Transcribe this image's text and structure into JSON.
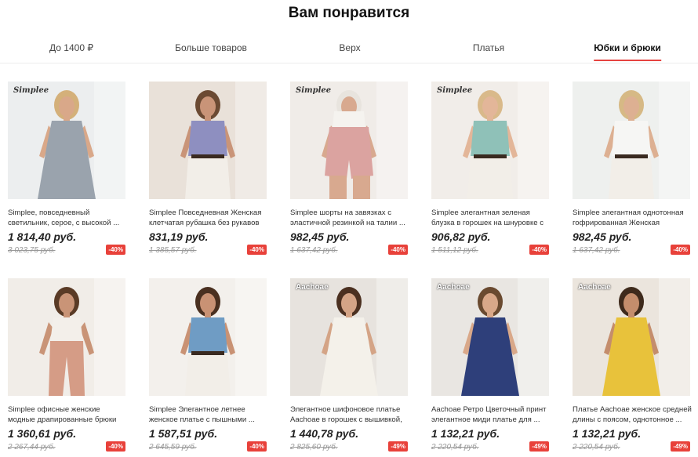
{
  "section_title": "Вам понравится",
  "tabs": [
    {
      "label": "До 1400 ₽"
    },
    {
      "label": "Больше товаров"
    },
    {
      "label": "Верх"
    },
    {
      "label": "Платья"
    },
    {
      "label": "Юбки и брюки"
    }
  ],
  "active_tab": "Юбки и брюки",
  "products": [
    {
      "brand_logo": "Simplee",
      "name": "Simplee, повседневный светильник, серое, с высокой ...",
      "price": "1 814,40 руб.",
      "old_price": "3 023,75 руб.",
      "discount": "-40%",
      "bg": "#eceeef",
      "dress": "#9aa3ad",
      "skin": "#d9a889",
      "hair": "#d4b07a"
    },
    {
      "brand_logo": "",
      "name": "Simplee Повседневная Женская клетчатая рубашка без рукавов с...",
      "price": "831,19 руб.",
      "old_price": "1 385,57 руб.",
      "discount": "-40%",
      "bg": "#e9e1d9",
      "dress": "#8e8fc0",
      "skin": "#c99478",
      "hair": "#6b4a33"
    },
    {
      "brand_logo": "Simplee",
      "name": "Simplee шорты на завязках с эластичной резинкой на талии ...",
      "price": "982,45 руб.",
      "old_price": "1 637,42 руб.",
      "discount": "-40%",
      "bg": "#f0ece8",
      "dress": "#dba3a0",
      "skin": "#d8a98f",
      "hair": "#e8e4de"
    },
    {
      "brand_logo": "Simplee",
      "name": "Simplee элегантная зеленая блузка в горошек на шнуровке с ...",
      "price": "906,82 руб.",
      "old_price": "1 511,12 руб.",
      "discount": "-40%",
      "bg": "#f1ede9",
      "dress": "#8fc1b8",
      "skin": "#e3b699",
      "hair": "#d9b98a"
    },
    {
      "brand_logo": "",
      "name": "Simplee элегантная однотонная гофрированная Женская футбол...",
      "price": "982,45 руб.",
      "old_price": "1 637,42 руб.",
      "discount": "-40%",
      "bg": "#eef0ee",
      "dress": "#f6f6f4",
      "skin": "#ddb092",
      "hair": "#d6b985"
    },
    {
      "brand_logo": "",
      "name": "Simplee офисные женские модные драпированные брюки весна ...",
      "price": "1 360,61 руб.",
      "old_price": "2 267,44 руб.",
      "discount": "-40%",
      "bg": "#f1ede8",
      "dress": "#d59c86",
      "skin": "#c99477",
      "hair": "#5a3b26"
    },
    {
      "brand_logo": "",
      "name": "Simplee Элегантное летнее женское платье с пышными ...",
      "price": "1 587,51 руб.",
      "old_price": "2 645,59 руб.",
      "discount": "-40%",
      "bg": "#f3f0ec",
      "dress": "#6f9cc4",
      "skin": "#c99274",
      "hair": "#4a3020"
    },
    {
      "brand_logo": "Aachoae",
      "name": "Элегантное шифоновое платье Aachoae в горошек с вышивкой, ...",
      "price": "1 440,78 руб.",
      "old_price": "2 825,60 руб.",
      "discount": "-49%",
      "bg": "#e7e3de",
      "dress": "#f4f1ea",
      "skin": "#d4a486",
      "hair": "#4b3020"
    },
    {
      "brand_logo": "Aachoae",
      "name": "Aachoae Ретро Цветочный принт элегантное миди платье для ...",
      "price": "1 132,21 руб.",
      "old_price": "2 220,54 руб.",
      "discount": "-49%",
      "bg": "#e9e6e2",
      "dress": "#2e3f7a",
      "skin": "#d9a889",
      "hair": "#6a4a30"
    },
    {
      "brand_logo": "Aachoae",
      "name": "Платье Aachoae женское средней длины с поясом, однотонное ...",
      "price": "1 132,21 руб.",
      "old_price": "2 220,54 руб.",
      "discount": "-49%",
      "bg": "#ebe5dd",
      "dress": "#e8c23b",
      "skin": "#c48d6c",
      "hair": "#3e2a1c"
    }
  ]
}
